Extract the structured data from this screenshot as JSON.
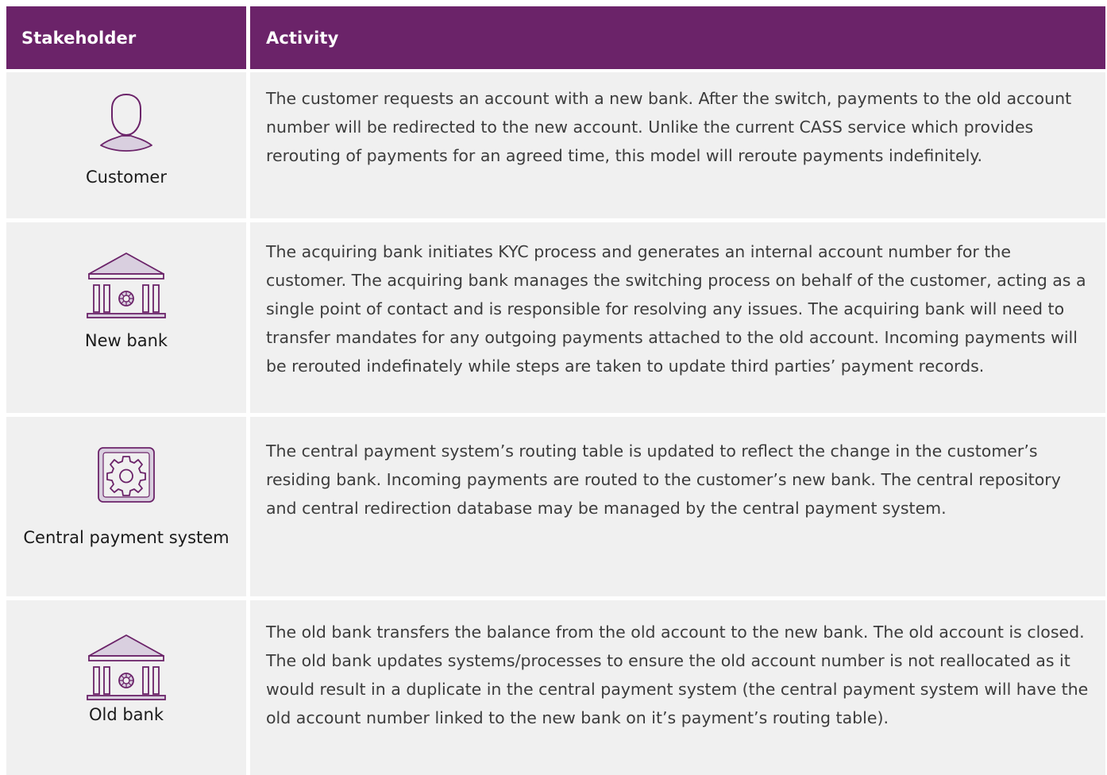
{
  "header": {
    "stakeholder_label": "Stakeholder",
    "activity_label": "Activity"
  },
  "colors": {
    "header_bg": "#6b2369",
    "icon_stroke": "#6b2369",
    "icon_fill": "#d9cfdf",
    "row_bg": "#f0f0f0"
  },
  "rows": [
    {
      "icon": "person-icon",
      "stakeholder": "Customer",
      "activity": "The customer requests an account with a new bank. After the switch, payments to the old account number will be redirected to the new account. Unlike the current CASS service which provides rerouting of payments for an agreed time, this model will reroute payments indefinitely."
    },
    {
      "icon": "bank-icon",
      "stakeholder": "New bank",
      "activity": "The acquiring bank initiates KYC process and generates an internal account number for the customer. The acquiring bank manages the switching process on behalf of the customer, acting as a single point of contact and is responsible for resolving any issues. The acquiring bank will need to transfer mandates for any outgoing payments attached to the old account. Incoming payments will be rerouted indefinately while steps are taken to update third parties’ payment records."
    },
    {
      "icon": "gear-icon",
      "stakeholder": "Central payment system",
      "activity": "The central payment system’s routing table is updated to reflect the change in the customer’s residing bank. Incoming payments are routed to the customer’s new bank. The central repository and central redirection database may be managed by the central payment system."
    },
    {
      "icon": "bank-icon",
      "stakeholder": "Old bank",
      "activity": "The old bank transfers the balance from the old account to the new bank. The old account is closed. The old bank updates systems/processes to ensure the old account number is not reallocated as it would result in a duplicate in the central payment system (the central payment system will have the old account number linked to the new bank on it’s payment’s routing table)."
    }
  ]
}
